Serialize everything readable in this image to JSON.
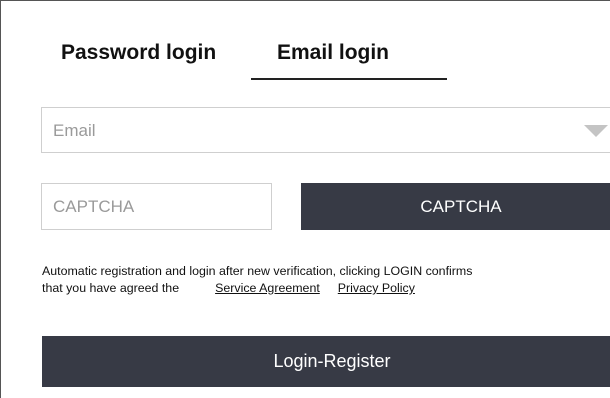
{
  "tabs": {
    "password_login": "Password login",
    "email_login": "Email login",
    "active": "email_login"
  },
  "email_field": {
    "placeholder": "Email"
  },
  "captcha": {
    "input_placeholder": "CAPTCHA",
    "button_label": "CAPTCHA"
  },
  "agreement": {
    "line1": "Automatic registration and login after new verification, clicking LOGIN confirms",
    "line2": "that you have agreed the",
    "service_agreement": "Service Agreement",
    "privacy_policy": "Privacy Policy"
  },
  "login_button": {
    "label": "Login-Register"
  },
  "colors": {
    "button_bg": "#373a45",
    "button_text": "#ffffff",
    "border": "#cfcfcf",
    "placeholder": "#9a9a9a"
  },
  "icons": {
    "email_dropdown": "chevron-down-icon"
  }
}
